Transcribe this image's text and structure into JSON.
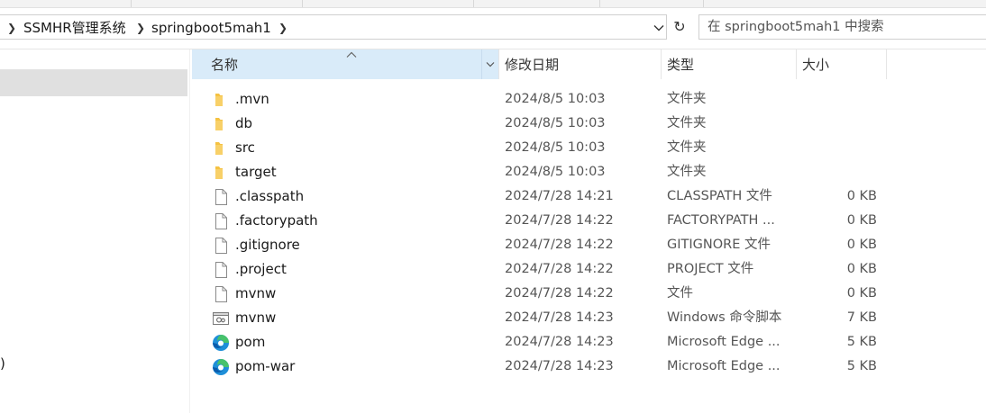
{
  "address_bar": {
    "breadcrumbs": [
      "SSMHR管理系统",
      "springboot5mah1"
    ]
  },
  "search": {
    "placeholder": "在 springboot5mah1 中搜索"
  },
  "nav_pane": {
    "partial_text": ")"
  },
  "columns": {
    "name": "名称",
    "date": "修改日期",
    "type": "类型",
    "size": "大小"
  },
  "files": [
    {
      "name": ".mvn",
      "date": "2024/8/5 10:03",
      "type": "文件夹",
      "size": "",
      "icon": "folder-icon"
    },
    {
      "name": "db",
      "date": "2024/8/5 10:03",
      "type": "文件夹",
      "size": "",
      "icon": "folder-icon"
    },
    {
      "name": "src",
      "date": "2024/8/5 10:03",
      "type": "文件夹",
      "size": "",
      "icon": "folder-icon"
    },
    {
      "name": "target",
      "date": "2024/8/5 10:03",
      "type": "文件夹",
      "size": "",
      "icon": "folder-icon"
    },
    {
      "name": ".classpath",
      "date": "2024/7/28 14:21",
      "type": "CLASSPATH 文件",
      "size": "0 KB",
      "icon": "file-icon"
    },
    {
      "name": ".factorypath",
      "date": "2024/7/28 14:22",
      "type": "FACTORYPATH ...",
      "size": "0 KB",
      "icon": "file-icon"
    },
    {
      "name": ".gitignore",
      "date": "2024/7/28 14:22",
      "type": "GITIGNORE 文件",
      "size": "0 KB",
      "icon": "file-icon"
    },
    {
      "name": ".project",
      "date": "2024/7/28 14:22",
      "type": "PROJECT 文件",
      "size": "0 KB",
      "icon": "file-icon"
    },
    {
      "name": "mvnw",
      "date": "2024/7/28 14:22",
      "type": "文件",
      "size": "0 KB",
      "icon": "file-icon"
    },
    {
      "name": "mvnw",
      "date": "2024/7/28 14:23",
      "type": "Windows 命令脚本",
      "size": "7 KB",
      "icon": "script-icon"
    },
    {
      "name": "pom",
      "date": "2024/7/28 14:23",
      "type": "Microsoft Edge ...",
      "size": "5 KB",
      "icon": "edge-icon"
    },
    {
      "name": "pom-war",
      "date": "2024/7/28 14:23",
      "type": "Microsoft Edge ...",
      "size": "5 KB",
      "icon": "edge-icon"
    }
  ],
  "colors": {
    "folder": "#f5c242",
    "sorted_header": "#d9ebf9",
    "nav_selected": "#e0e0e0"
  }
}
